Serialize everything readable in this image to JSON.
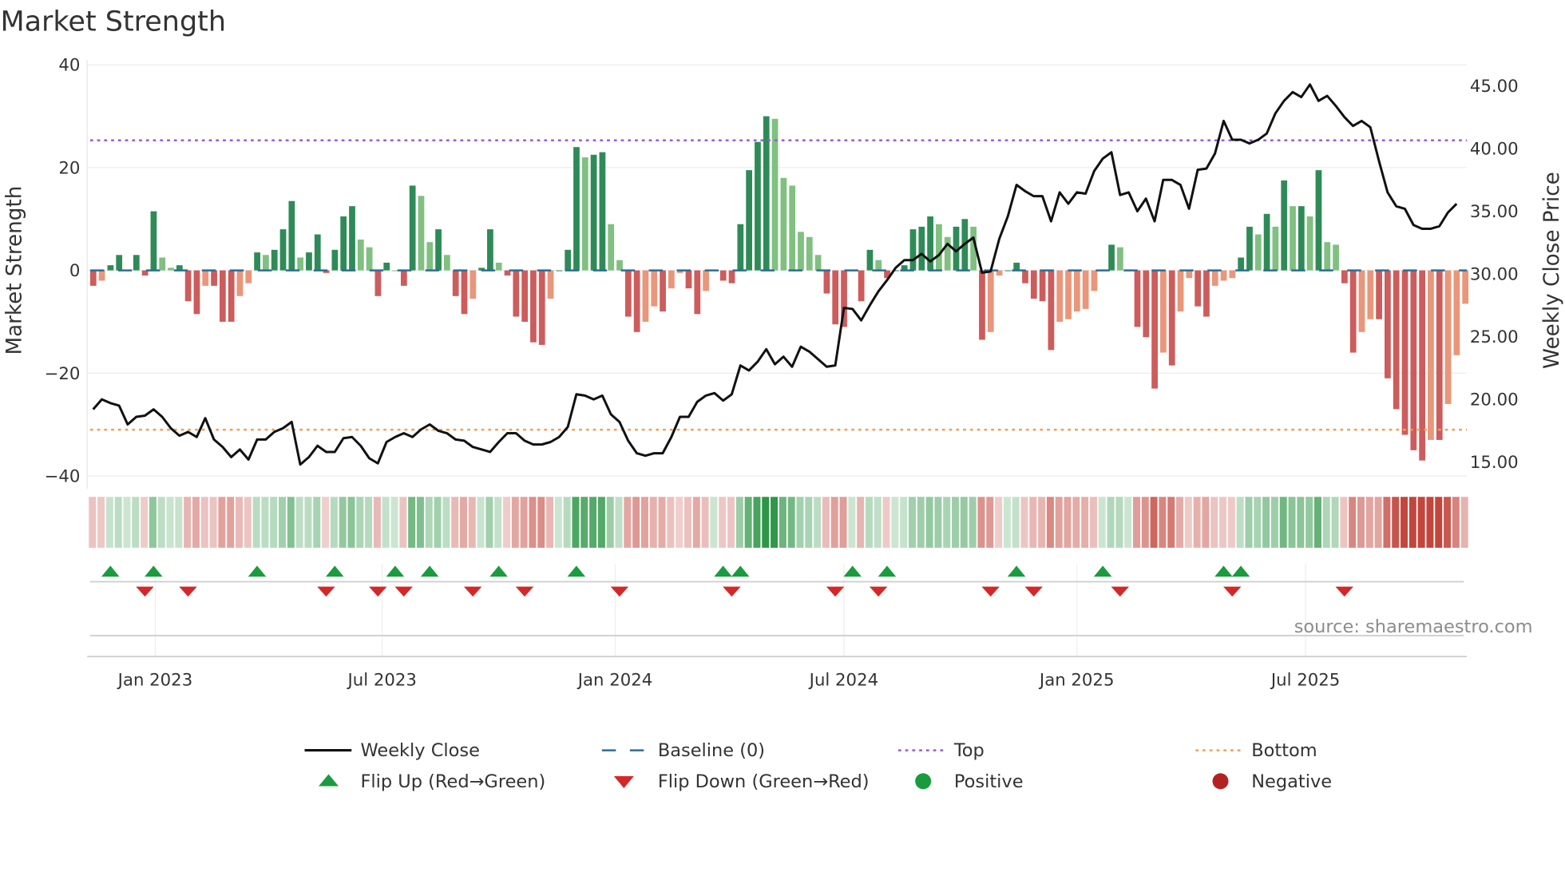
{
  "chart_data": {
    "type": "bar",
    "title": "Market Strength",
    "ylabel": "Market Strength",
    "y2label": "Weekly Close Price",
    "ylim": [
      -40,
      40
    ],
    "y2lim": [
      15,
      45
    ],
    "yticks": [
      "40",
      "20",
      "0",
      "−20",
      "−40"
    ],
    "yticks_values": [
      40,
      20,
      0,
      -20,
      -40
    ],
    "y2ticks": [
      "45.00",
      "40.00",
      "35.00",
      "30.00",
      "25.00",
      "20.00",
      "15.00"
    ],
    "y2ticks_values": [
      45,
      40,
      35,
      30,
      25,
      20,
      15
    ],
    "xticks": [
      "Jan 2023",
      "Jul 2023",
      "Jan 2024",
      "Jul 2024",
      "Jan 2025",
      "Jul 2025"
    ],
    "xticks_week_index": [
      7.2,
      33.5,
      60.5,
      87,
      114,
      140.5
    ],
    "top_level": 25.3,
    "bottom_level": -31,
    "baseline": 0,
    "strength": [
      -3,
      -2,
      1,
      3,
      0,
      3,
      -1,
      11.5,
      2.5,
      0.5,
      1,
      -6,
      -8.5,
      -3,
      -3,
      -10,
      -10,
      -5,
      -2.5,
      3.5,
      3,
      4,
      8,
      13.5,
      2.5,
      3.5,
      7,
      -0.5,
      4,
      10.5,
      12.5,
      6,
      4.5,
      -5,
      1.5,
      0,
      -3,
      16.5,
      14.5,
      5.5,
      8,
      3,
      -5,
      -8.5,
      -5.5,
      0.5,
      8,
      1.5,
      -1,
      -9,
      -10,
      -14,
      -14.5,
      -5.5,
      0,
      4,
      24,
      22,
      22.5,
      23,
      9,
      2,
      -9,
      -12,
      -10,
      -7,
      -8,
      -3.5,
      -0.5,
      -3.5,
      -8.5,
      -4,
      0,
      -2,
      -2.5,
      9,
      19.5,
      25,
      30,
      29.5,
      18,
      16.5,
      7.5,
      6.5,
      3,
      -4.5,
      -10.5,
      -11,
      0,
      -6,
      4,
      2,
      -1.5,
      0,
      1,
      8,
      8.5,
      10.5,
      9,
      6.5,
      8.5,
      10,
      8.5,
      -13.5,
      -12,
      -1,
      0,
      1.5,
      -2.5,
      -5.5,
      -6,
      -15.5,
      -10,
      -9.5,
      -8,
      -7.5,
      -4,
      0,
      5,
      4.5,
      0,
      -11,
      -13,
      -23,
      -16,
      -18.5,
      -8,
      -1.5,
      -7,
      -9,
      -3,
      -2,
      -1.5,
      2.5,
      8.5,
      7,
      11,
      8.5,
      17.5,
      12.5,
      12.5,
      10.5,
      19.5,
      5.5,
      5,
      -2.5,
      -16,
      -12,
      -9.5,
      -9.5,
      -21,
      -27,
      -32,
      -35,
      -37,
      -33,
      -33,
      -26,
      -16.5,
      -6.5
    ],
    "weekly_close": [
      19.2,
      20,
      19.7,
      19.5,
      18,
      18.6,
      18.7,
      19.2,
      18.6,
      17.7,
      17.1,
      17.4,
      17,
      18.5,
      16.8,
      16.2,
      15.4,
      16,
      15.2,
      16.8,
      16.8,
      17.4,
      17.7,
      18.2,
      14.8,
      15.4,
      16.3,
      15.8,
      15.8,
      16.9,
      17,
      16.3,
      15.3,
      14.9,
      16.6,
      17,
      17.3,
      17,
      17.6,
      18,
      17.5,
      17.3,
      16.8,
      16.7,
      16.2,
      16,
      15.8,
      16.6,
      17.3,
      17.3,
      16.7,
      16.4,
      16.4,
      16.6,
      17,
      17.8,
      20.4,
      20.3,
      20,
      20.3,
      18.8,
      18.2,
      16.7,
      15.7,
      15.5,
      15.7,
      15.7,
      17,
      18.6,
      18.6,
      19.8,
      20.3,
      20.5,
      19.9,
      20.4,
      22.7,
      22.3,
      23,
      24,
      22.8,
      23.4,
      22.6,
      24.2,
      23.8,
      23.2,
      22.6,
      22.7,
      27.3,
      27.2,
      26.3,
      27.5,
      28.6,
      29.5,
      30.5,
      31.1,
      31.1,
      31.6,
      31,
      31.5,
      32.4,
      31.8,
      32.4,
      32.9,
      30.1,
      30.2,
      32.8,
      34.6,
      37.1,
      36.6,
      36.2,
      36.2,
      34.2,
      36.5,
      35.6,
      36.5,
      36.4,
      38.2,
      39.2,
      39.7,
      36.3,
      36.5,
      35,
      36,
      34.2,
      37.5,
      37.5,
      37.1,
      35.2,
      38.3,
      38.4,
      39.6,
      42.2,
      40.7,
      40.7,
      40.4,
      40.7,
      41.2,
      42.8,
      43.8,
      44.5,
      44.1,
      45.1,
      43.8,
      44.2,
      43.4,
      42.5,
      41.8,
      42.2,
      41.7,
      39,
      36.5,
      35.4,
      35.2,
      33.9,
      33.6,
      33.6,
      33.8,
      34.9,
      35.6
    ],
    "flip_up_weeks": [
      2,
      7,
      19,
      28,
      35,
      39,
      47,
      56,
      73,
      75,
      88,
      92,
      107,
      117,
      131,
      133
    ],
    "flip_down_weeks": [
      6,
      11,
      27,
      33,
      36,
      44,
      50,
      61,
      74,
      86,
      91,
      104,
      109,
      119,
      132,
      145
    ],
    "legend_placement": "bottom",
    "grid": true
  },
  "source": "source: sharemaestro.com",
  "legend": [
    {
      "label": "Weekly Close",
      "kind": "line"
    },
    {
      "label": "Baseline (0)",
      "kind": "dash"
    },
    {
      "label": "Top",
      "kind": "dotted-purple"
    },
    {
      "label": "Bottom",
      "kind": "dotted-orange"
    },
    {
      "label": "Flip Up (Red→Green)",
      "kind": "tri-up"
    },
    {
      "label": "Flip Down (Green→Red)",
      "kind": "tri-down"
    },
    {
      "label": "Positive",
      "kind": "dot-green"
    },
    {
      "label": "Negative",
      "kind": "dot-red"
    }
  ],
  "colors": {
    "pos_strong": "#2e8b57",
    "pos_weak": "#80c080",
    "neg_strong": "#cd5c5c",
    "neg_weak": "#e9967a",
    "baseline": "#2a6f97",
    "top": "#9b59d6",
    "bottom": "#f0a050",
    "line": "#111111",
    "flip_up": "#1a9c3e",
    "flip_down": "#d62728",
    "positive": "#1a9c3e",
    "negative": "#b22222"
  }
}
